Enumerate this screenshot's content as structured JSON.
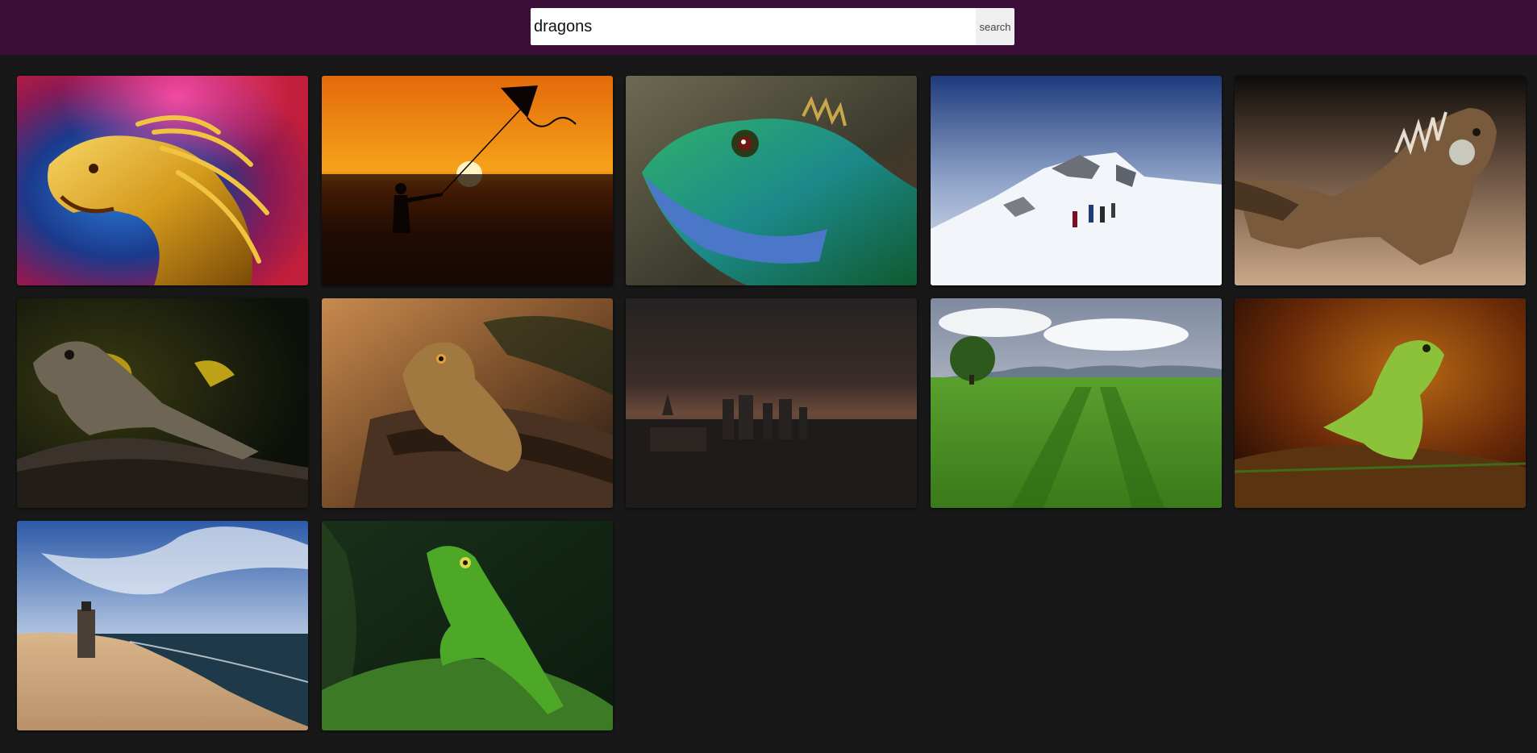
{
  "search": {
    "value": "dragons",
    "button_label": "search"
  },
  "results": [
    {
      "subject": "golden-dragon-statue"
    },
    {
      "subject": "kite-silhouette-sunset"
    },
    {
      "subject": "green-water-dragon-closeup"
    },
    {
      "subject": "mountaineers-snow"
    },
    {
      "subject": "iguana-on-sand"
    },
    {
      "subject": "frilled-lizard-on-rock"
    },
    {
      "subject": "bearded-dragon-on-log"
    },
    {
      "subject": "dark-city-skyline"
    },
    {
      "subject": "wheat-field-tree"
    },
    {
      "subject": "green-iguana-orange-background"
    },
    {
      "subject": "lighthouse-dunes-sea"
    },
    {
      "subject": "green-lizard-on-leaf"
    }
  ]
}
